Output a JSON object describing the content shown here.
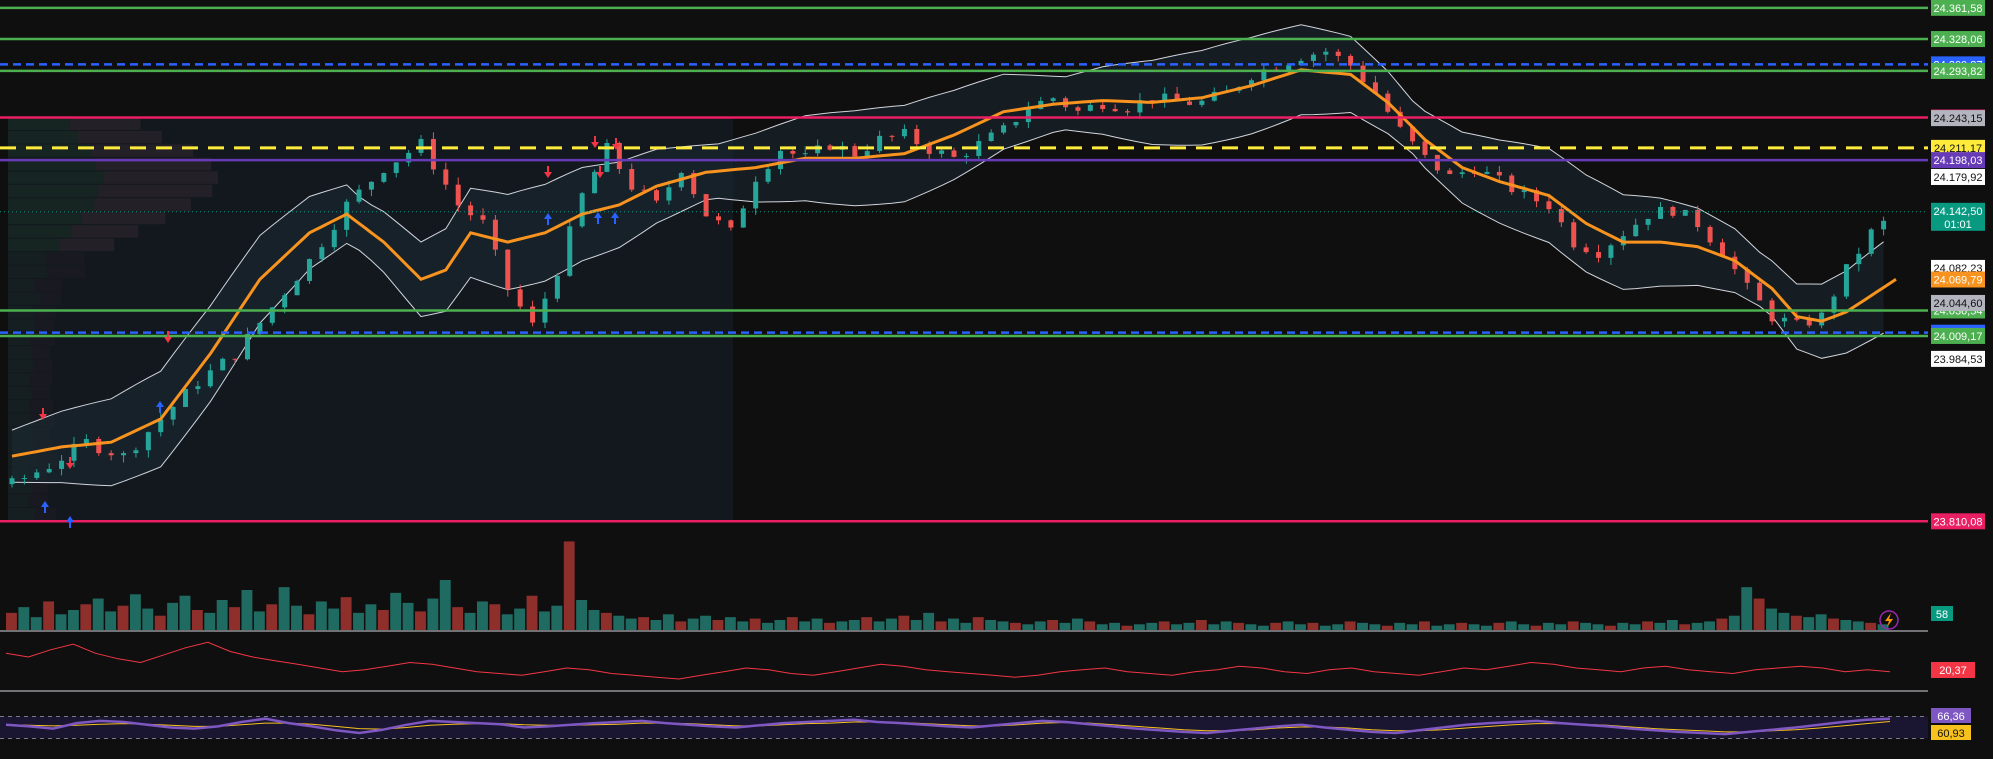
{
  "chart_data": {
    "type": "candlestick",
    "price_axis": {
      "ylim": [
        23790,
        24370
      ],
      "levels": [
        {
          "label": "24.361,58",
          "value": 24361.58,
          "color": "#4caf50",
          "style": "solid"
        },
        {
          "label": "24.328,06",
          "value": 24328.06,
          "color": "#4caf50",
          "style": "solid"
        },
        {
          "label": "24.300,87",
          "value": 24300.87,
          "color": "#2962ff",
          "style": "dashed"
        },
        {
          "label": "24.293,82",
          "value": 24293.82,
          "color": "#4caf50",
          "style": "solid"
        },
        {
          "label": "24.243,80",
          "value": 24243.8,
          "color": "#e91e63",
          "style": "solid"
        },
        {
          "label": "24.211,17",
          "value": 24211.17,
          "color": "#ffeb3b",
          "style": "dashed"
        },
        {
          "label": "24.198,03",
          "value": 24198.03,
          "color": "#673ab7",
          "style": "solid"
        },
        {
          "label": "24.036,54",
          "value": 24036.54,
          "color": "#4caf50",
          "style": "solid"
        },
        {
          "label": "24.012,67",
          "value": 24012.67,
          "color": "#2962ff",
          "style": "dashed"
        },
        {
          "label": "24.009,17",
          "value": 24009.17,
          "color": "#4caf50",
          "style": "solid"
        },
        {
          "label": "23.810,08",
          "value": 23810.08,
          "color": "#e91e63",
          "style": "solid"
        }
      ],
      "labels": [
        {
          "text": "24.243,15",
          "value": 24243.15,
          "bg": "#b2b5be",
          "fg": "#111111"
        },
        {
          "text": "24.179,92",
          "value": 24179.92,
          "bg": "#ffffff",
          "fg": "#111111"
        },
        {
          "text": "24.082,23",
          "value": 24082.23,
          "bg": "#ffffff",
          "fg": "#111111"
        },
        {
          "text": "24.069,79",
          "value": 24069.79,
          "bg": "#f7931e",
          "fg": "#ffffff"
        },
        {
          "text": "24.044,60",
          "value": 24044.6,
          "bg": "#b2b5be",
          "fg": "#111111"
        },
        {
          "text": "23.984,53",
          "value": 23984.53,
          "bg": "#ffffff",
          "fg": "#111111"
        }
      ],
      "current_price": {
        "text": "24.142,50",
        "countdown": "01:01",
        "value": 24142.5,
        "bg": "#089981"
      }
    },
    "close_path": [
      [
        0,
        23850
      ],
      [
        3,
        23870
      ],
      [
        6,
        23895
      ],
      [
        9,
        23880
      ],
      [
        12,
        23920
      ],
      [
        15,
        23960
      ],
      [
        18,
        23990
      ],
      [
        21,
        24040
      ],
      [
        24,
        24090
      ],
      [
        27,
        24150
      ],
      [
        30,
        24190
      ],
      [
        33,
        24215
      ],
      [
        36,
        24150
      ],
      [
        38,
        24130
      ],
      [
        40,
        24060
      ],
      [
        42,
        24020
      ],
      [
        44,
        24080
      ],
      [
        46,
        24160
      ],
      [
        48,
        24210
      ],
      [
        50,
        24170
      ],
      [
        52,
        24150
      ],
      [
        54,
        24190
      ],
      [
        56,
        24140
      ],
      [
        58,
        24120
      ],
      [
        60,
        24180
      ],
      [
        62,
        24210
      ],
      [
        64,
        24200
      ],
      [
        66,
        24215
      ],
      [
        68,
        24205
      ],
      [
        70,
        24220
      ],
      [
        72,
        24225
      ],
      [
        74,
        24210
      ],
      [
        76,
        24200
      ],
      [
        78,
        24215
      ],
      [
        80,
        24230
      ],
      [
        82,
        24255
      ],
      [
        84,
        24265
      ],
      [
        86,
        24250
      ],
      [
        88,
        24260
      ],
      [
        90,
        24255
      ],
      [
        92,
        24265
      ],
      [
        94,
        24260
      ],
      [
        96,
        24260
      ],
      [
        98,
        24270
      ],
      [
        100,
        24290
      ],
      [
        102,
        24300
      ],
      [
        104,
        24310
      ],
      [
        106,
        24315
      ],
      [
        108,
        24300
      ],
      [
        110,
        24270
      ],
      [
        112,
        24230
      ],
      [
        114,
        24200
      ],
      [
        116,
        24180
      ],
      [
        118,
        24190
      ],
      [
        120,
        24175
      ],
      [
        122,
        24160
      ],
      [
        124,
        24150
      ],
      [
        126,
        24110
      ],
      [
        128,
        24100
      ],
      [
        130,
        24120
      ],
      [
        132,
        24140
      ],
      [
        134,
        24145
      ],
      [
        136,
        24130
      ],
      [
        138,
        24100
      ],
      [
        140,
        24060
      ],
      [
        142,
        24030
      ],
      [
        144,
        24020
      ],
      [
        146,
        24030
      ],
      [
        148,
        24080
      ],
      [
        150,
        24120
      ],
      [
        152,
        24140
      ]
    ],
    "ma_path": [
      [
        0,
        23880
      ],
      [
        4,
        23890
      ],
      [
        8,
        23895
      ],
      [
        12,
        23920
      ],
      [
        16,
        23990
      ],
      [
        20,
        24070
      ],
      [
        24,
        24120
      ],
      [
        27,
        24140
      ],
      [
        30,
        24110
      ],
      [
        33,
        24070
      ],
      [
        35,
        24080
      ],
      [
        37,
        24120
      ],
      [
        40,
        24110
      ],
      [
        43,
        24120
      ],
      [
        46,
        24140
      ],
      [
        49,
        24150
      ],
      [
        52,
        24170
      ],
      [
        56,
        24185
      ],
      [
        60,
        24190
      ],
      [
        64,
        24200
      ],
      [
        68,
        24200
      ],
      [
        72,
        24205
      ],
      [
        76,
        24225
      ],
      [
        80,
        24250
      ],
      [
        84,
        24258
      ],
      [
        88,
        24262
      ],
      [
        92,
        24260
      ],
      [
        96,
        24265
      ],
      [
        100,
        24278
      ],
      [
        104,
        24295
      ],
      [
        108,
        24290
      ],
      [
        111,
        24260
      ],
      [
        114,
        24220
      ],
      [
        117,
        24190
      ],
      [
        120,
        24175
      ],
      [
        124,
        24160
      ],
      [
        127,
        24130
      ],
      [
        130,
        24110
      ],
      [
        133,
        24110
      ],
      [
        136,
        24105
      ],
      [
        139,
        24090
      ],
      [
        142,
        24060
      ],
      [
        144,
        24030
      ],
      [
        146,
        24025
      ],
      [
        148,
        24035
      ],
      [
        152,
        24070
      ]
    ],
    "band_width": 40,
    "rows": 152,
    "volume": {
      "label": "58",
      "values": [
        12,
        16,
        9,
        20,
        11,
        14,
        18,
        22,
        13,
        17,
        25,
        15,
        10,
        19,
        24,
        14,
        12,
        21,
        16,
        28,
        13,
        18,
        30,
        17,
        11,
        20,
        15,
        23,
        12,
        18,
        14,
        26,
        19,
        13,
        22,
        35,
        16,
        12,
        20,
        18,
        11,
        15,
        24,
        13,
        17,
        62,
        21,
        14,
        12,
        10,
        8,
        9,
        7,
        11,
        6,
        8,
        10,
        7,
        9,
        6,
        8,
        5,
        7,
        9,
        6,
        8,
        5,
        6,
        7,
        9,
        6,
        8,
        10,
        7,
        12,
        6,
        8,
        5,
        9,
        7,
        6,
        5,
        4,
        6,
        7,
        5,
        8,
        6,
        4,
        5,
        3,
        4,
        5,
        6,
        4,
        5,
        7,
        4,
        6,
        5,
        4,
        3,
        5,
        6,
        4,
        5,
        3,
        4,
        6,
        5,
        4,
        3,
        5,
        4,
        6,
        3,
        4,
        5,
        4,
        3,
        5,
        6,
        4,
        3,
        5,
        4,
        6,
        5,
        4,
        3,
        5,
        4,
        6,
        5,
        7,
        4,
        5,
        6,
        8,
        10,
        30,
        22,
        15,
        12,
        10,
        9,
        11,
        8,
        7,
        6,
        5,
        4
      ],
      "max": 70
    },
    "oscillator_1": {
      "label": "20,37",
      "color": "#f23645",
      "values": [
        30,
        28,
        32,
        35,
        30,
        27,
        25,
        29,
        33,
        36,
        31,
        28,
        26,
        24,
        22,
        20,
        21,
        23,
        25,
        24,
        22,
        20,
        19,
        18,
        20,
        22,
        21,
        19,
        18,
        17,
        16,
        18,
        20,
        22,
        21,
        19,
        18,
        20,
        22,
        24,
        23,
        21,
        20,
        19,
        18,
        17,
        18,
        20,
        21,
        22,
        20,
        19,
        18,
        20,
        21,
        23,
        22,
        20,
        19,
        21,
        22,
        20,
        19,
        18,
        20,
        22,
        21,
        23,
        25,
        24,
        22,
        21,
        20,
        22,
        23,
        21,
        20,
        19,
        21,
        22,
        23,
        22,
        20,
        21,
        20
      ]
    },
    "rsi": {
      "value_label": "66,36",
      "signal_label": "60,93",
      "levels": [
        70,
        30
      ],
      "ylim": [
        0,
        100
      ],
      "values": [
        55,
        52,
        48,
        58,
        62,
        60,
        55,
        50,
        48,
        52,
        60,
        66,
        58,
        52,
        45,
        40,
        46,
        55,
        62,
        60,
        58,
        56,
        50,
        52,
        55,
        58,
        60,
        62,
        58,
        55,
        52,
        50,
        54,
        58,
        60,
        62,
        64,
        60,
        58,
        55,
        52,
        50,
        54,
        58,
        62,
        60,
        56,
        52,
        48,
        45,
        42,
        40,
        44,
        48,
        52,
        55,
        50,
        46,
        42,
        40,
        45,
        50,
        55,
        58,
        60,
        62,
        58,
        55,
        52,
        48,
        45,
        42,
        40,
        38,
        42,
        46,
        50,
        55,
        60,
        64,
        66
      ],
      "signal": [
        55,
        54,
        53,
        54,
        56,
        57,
        56,
        54,
        52,
        52,
        55,
        58,
        58,
        56,
        52,
        48,
        47,
        50,
        54,
        56,
        57,
        57,
        55,
        54,
        54,
        55,
        56,
        58,
        58,
        57,
        55,
        53,
        53,
        55,
        57,
        58,
        60,
        60,
        59,
        57,
        55,
        53,
        53,
        55,
        58,
        59,
        58,
        55,
        52,
        49,
        46,
        44,
        44,
        46,
        49,
        51,
        51,
        49,
        46,
        44,
        44,
        46,
        49,
        52,
        55,
        57,
        57,
        56,
        54,
        51,
        48,
        46,
        44,
        42,
        42,
        44,
        46,
        49,
        53,
        57,
        61
      ]
    },
    "markers": [
      {
        "kind": "buy",
        "x": 45,
        "y": 507
      },
      {
        "kind": "buy",
        "x": 70,
        "y": 522
      },
      {
        "kind": "sell",
        "x": 43,
        "y": 414
      },
      {
        "kind": "sell",
        "x": 70,
        "y": 463
      },
      {
        "kind": "sell",
        "x": 168,
        "y": 337
      },
      {
        "kind": "buy",
        "x": 160,
        "y": 407
      },
      {
        "kind": "sell",
        "x": 548,
        "y": 172
      },
      {
        "kind": "buy",
        "x": 548,
        "y": 219
      },
      {
        "kind": "sell",
        "x": 600,
        "y": 172
      },
      {
        "kind": "buy",
        "x": 598,
        "y": 218
      },
      {
        "kind": "buy",
        "x": 615,
        "y": 218
      },
      {
        "kind": "sell",
        "x": 616,
        "y": 144
      },
      {
        "kind": "sell",
        "x": 595,
        "y": 142
      }
    ]
  },
  "colors": {
    "up": "#26a69a",
    "down": "#ef5350",
    "ma": "#f7931e",
    "band": "#d1d4dc",
    "rsi": "#7e57c2",
    "rsi_signal": "#f7c21e",
    "background": "#0f0f0f"
  },
  "icons": {
    "alert": "lightning-icon"
  }
}
